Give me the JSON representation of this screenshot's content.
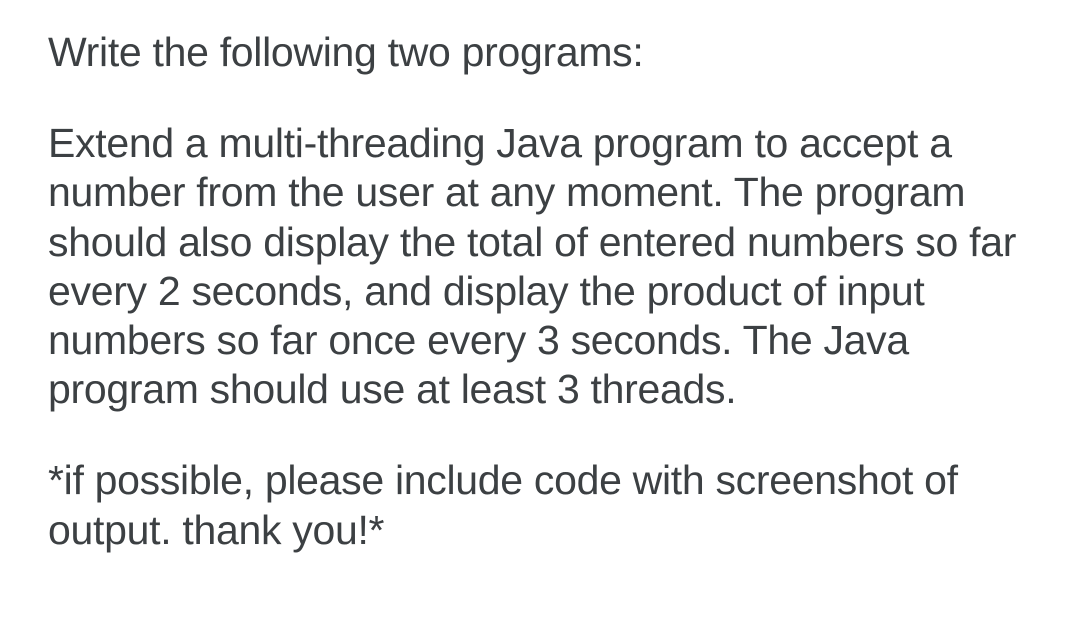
{
  "paragraphs": {
    "p1": "Write the following two programs:",
    "p2": "Extend a multi-threading Java program to accept a number from the user at any moment. The program should also display the total of entered numbers so far every 2 seconds, and display the product of input numbers so far once every 3 seconds. The Java program should use at least 3 threads.",
    "p3": "*if possible, please include code with screenshot of output. thank you!*"
  }
}
